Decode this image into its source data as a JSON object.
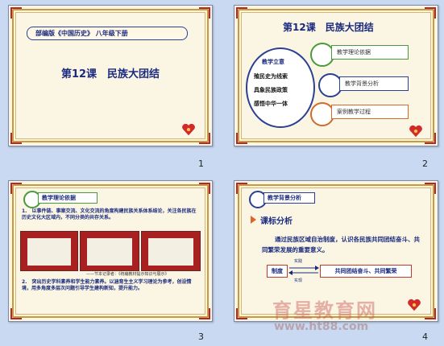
{
  "slides": [
    {
      "number": "1",
      "header": "部编版《中国历史》 八年级下册",
      "title": "第12课　民族大团结"
    },
    {
      "number": "2",
      "title": "第12课　民族大团结",
      "center_lines": [
        "教学立意",
        "殖民史为线索",
        "具象民族政策",
        "感悟中华一体"
      ],
      "items": [
        "教学理论依据",
        "教学背景分析",
        "案例教学过程"
      ]
    },
    {
      "number": "3",
      "label": "教学理论依据",
      "para1": "1.　以事件链、事案交流、文化交流的角度构建民族关系体系结论，关注各民族在历史文化大区域内，不同分类的共存关系。",
      "images_caption": "——节本记录者：《统编教材提示知识与展示》",
      "para2": "2.　突出历史学科素养和学生能力素养。以涵育生主义学习理论为参考，创设情境，用多角度多层次问题引导学生建构新知，提升能力。"
    },
    {
      "number": "4",
      "label": "教学背景分析",
      "section": "课标分析",
      "body": "通过民族区域自治制度，认识各民族共同团结奋斗、共同繁荣发展的重要意义。",
      "left_box": "制度",
      "right_box": "共同团结奋斗、共同繁荣",
      "arrow_top": "实践",
      "arrow_bottom": "实现"
    }
  ],
  "watermark": {
    "cn": "育星教育网",
    "url": "www.ht88.com"
  }
}
